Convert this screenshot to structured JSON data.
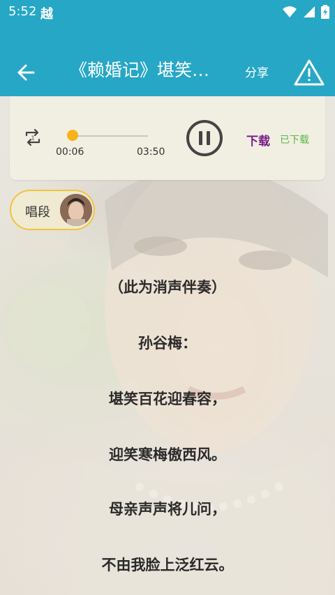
{
  "status_bar": {
    "time": "5:52",
    "carrier": "越"
  },
  "toolbar": {
    "title": "《赖婚记》堪笑…",
    "share_label": "分享",
    "icons": {
      "back": "back-arrow-icon",
      "warning": "warning-triangle-icon"
    }
  },
  "player": {
    "current_time": "00:06",
    "total_time": "03:50",
    "progress": 0.03,
    "state": "playing",
    "download_label": "下载",
    "downloaded_label": "已下载",
    "colors": {
      "thumb": "#f7b21a",
      "download": "#7a1f87",
      "downloaded": "#59b54a"
    }
  },
  "chip": {
    "label": "唱段"
  },
  "lyrics": [
    "（此为消声伴奏）",
    "孙谷梅：",
    "堪笑百花迎春容，",
    "迎笑寒梅傲西风。",
    "母亲声声将儿问，",
    "不由我脸上泛红云。"
  ],
  "colors": {
    "header": "#27a7c6"
  }
}
